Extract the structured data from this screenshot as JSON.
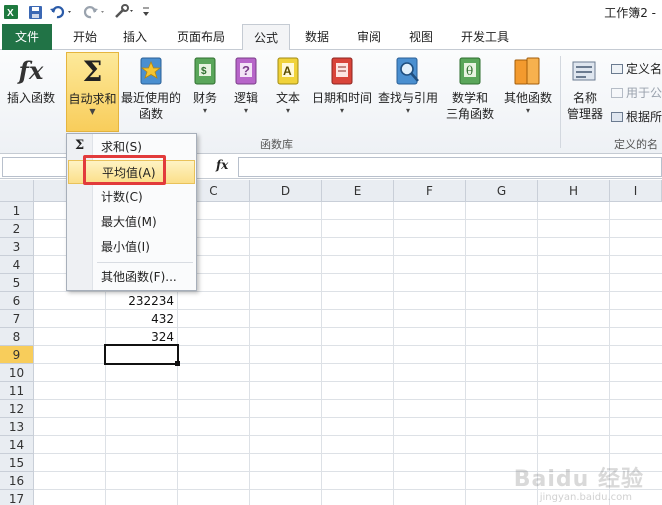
{
  "window": {
    "title": "工作簿2 -"
  },
  "tabs": [
    {
      "label": "文件"
    },
    {
      "label": "开始"
    },
    {
      "label": "插入"
    },
    {
      "label": "页面布局"
    },
    {
      "label": "公式"
    },
    {
      "label": "数据"
    },
    {
      "label": "审阅"
    },
    {
      "label": "视图"
    },
    {
      "label": "开发工具"
    }
  ],
  "ribbon": {
    "insert_function": {
      "label": "插入函数",
      "glyph": "fx"
    },
    "autosum": {
      "label": "自动求和",
      "glyph": "Σ"
    },
    "recent": {
      "label1": "最近使用的",
      "label2": "函数"
    },
    "financial": {
      "label": "财务"
    },
    "logical": {
      "label": "逻辑"
    },
    "text": {
      "label": "文本"
    },
    "datetime": {
      "label": "日期和时间"
    },
    "lookup": {
      "label": "查找与引用"
    },
    "math": {
      "label1": "数学和",
      "label2": "三角函数"
    },
    "more": {
      "label": "其他函数"
    },
    "name_manager": {
      "label1": "名称",
      "label2": "管理器"
    },
    "define_name": "定义名",
    "use_in_formula": "用于公",
    "create_from_selection": "根据所",
    "group_library": "函数库",
    "group_names": "定义的名"
  },
  "formula_bar": {
    "fx": "fx",
    "name_box_value": ""
  },
  "columns": [
    "C",
    "D",
    "E",
    "F",
    "G",
    "H",
    "I"
  ],
  "rows": [
    "1",
    "2",
    "3",
    "4",
    "5",
    "6",
    "7",
    "8",
    "9",
    "10",
    "11",
    "12",
    "13",
    "14",
    "15",
    "16",
    "17"
  ],
  "cells": {
    "B6": "232234",
    "B7": "432",
    "B8": "324"
  },
  "autosum_menu": {
    "items": [
      "求和(S)",
      "平均值(A)",
      "计数(C)",
      "最大值(M)",
      "最小值(I)"
    ],
    "more": "其他函数(F)...",
    "sum_glyph": "Σ"
  },
  "watermark": {
    "text": "Baidu 经验",
    "sub": "jingyan.baidu.com"
  },
  "colors": {
    "file_tab": "#217346",
    "highlight": "#f8cd5b",
    "annotation": "#e23b3b"
  }
}
